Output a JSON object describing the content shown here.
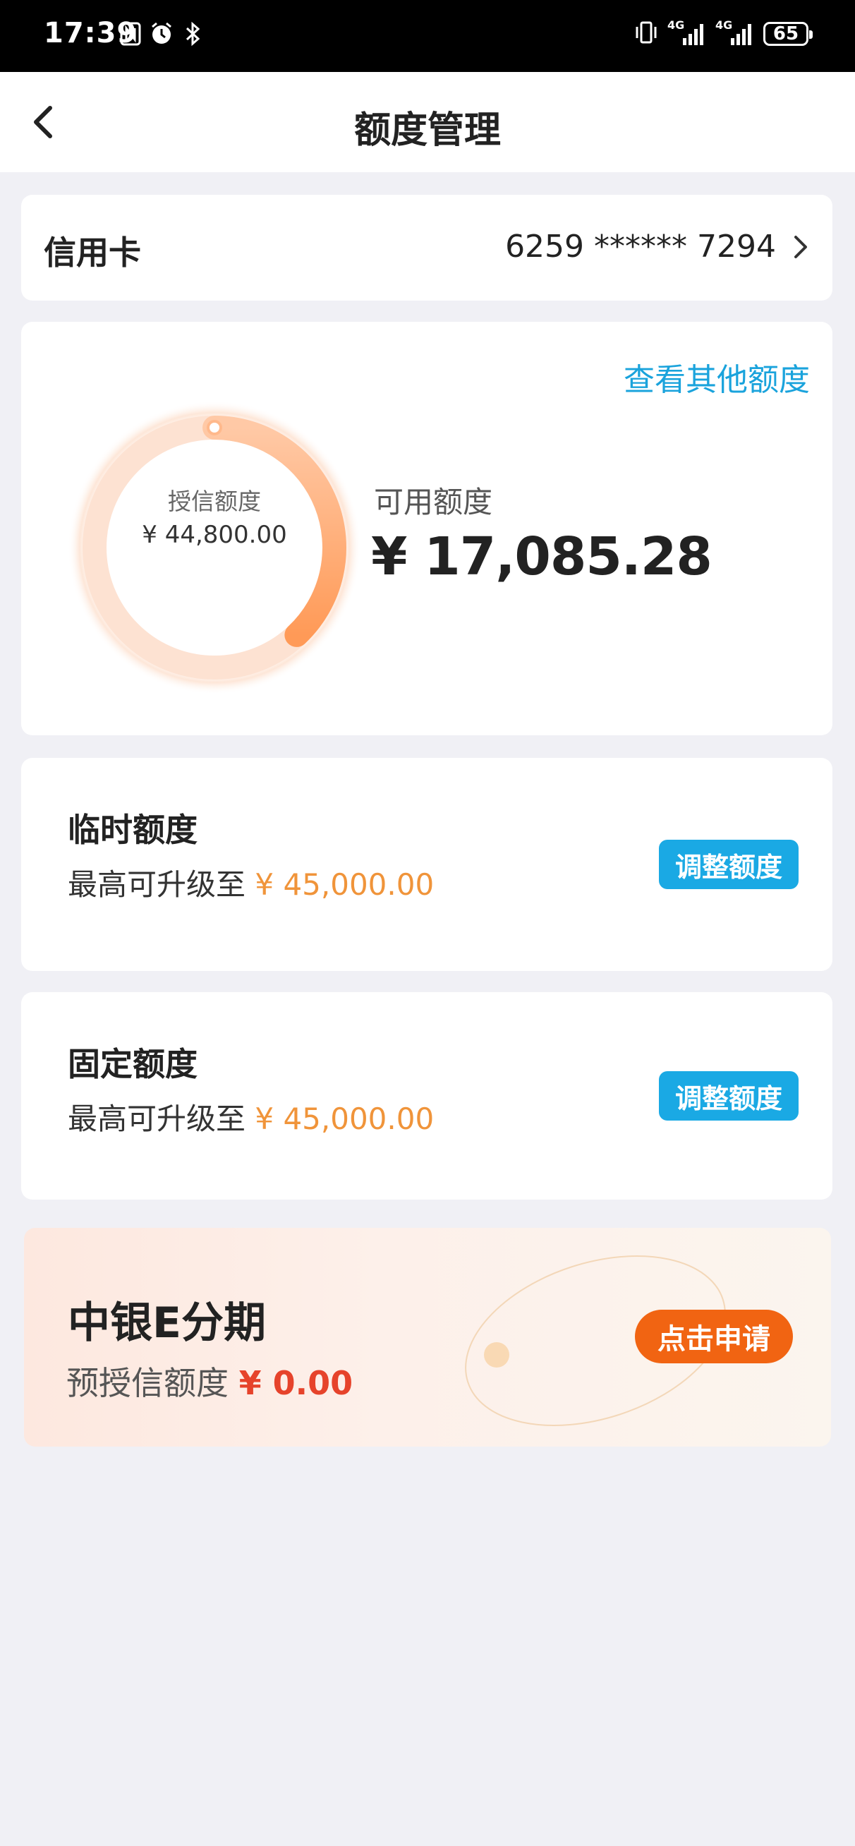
{
  "status_bar": {
    "time": "17:39",
    "network_1": "4G",
    "network_2": "4G",
    "battery": "65",
    "icons": [
      "nfc-icon",
      "alarm-icon",
      "bluetooth-icon",
      "vibrate-icon",
      "signal-icon",
      "signal-icon",
      "battery-icon"
    ]
  },
  "header": {
    "title": "额度管理",
    "back_icon": "chevron-left-icon"
  },
  "card_row": {
    "label": "信用卡",
    "number": "6259 ****** 7294"
  },
  "credit": {
    "other_quota_link": "查看其他额度",
    "gauge_label": "授信额度",
    "gauge_value": "¥ 44,800.00",
    "gauge_used_fraction": 0.38,
    "available_label": "可用额度",
    "available_value": "¥ 17,085.28"
  },
  "temp_quota": {
    "title": "临时额度",
    "sub_prefix": "最高可升级至",
    "sub_amount": "¥ 45,000.00",
    "button": "调整额度"
  },
  "fixed_quota": {
    "title": "固定额度",
    "sub_prefix": "最高可升级至",
    "sub_amount": "¥ 45,000.00",
    "button": "调整额度"
  },
  "promo": {
    "title": "中银E分期",
    "sub_prefix": "预授信额度",
    "sub_amount": "¥ 0.00",
    "button": "点击申请"
  },
  "colors": {
    "accent_blue": "#1aa3dc",
    "button_blue": "#1aa9e4",
    "amount_orange": "#f0943a",
    "promo_red": "#e6432b",
    "apply_orange": "#f16412"
  }
}
